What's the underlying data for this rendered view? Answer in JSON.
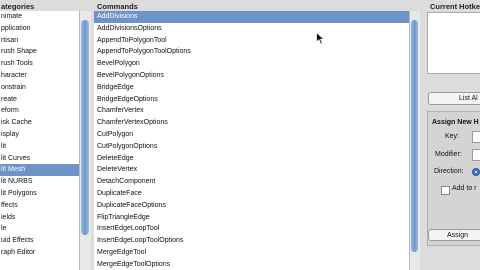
{
  "headers": {
    "categories": "ategories",
    "commands": "Commands",
    "current": "Current Hotke"
  },
  "categories": [
    "nimate",
    "pplication",
    "rtisan",
    "rush Shape",
    "rush Tools",
    "haracter",
    "onstrain",
    "reate",
    "eform",
    "isk Cache",
    "isplay",
    "lit",
    "lit Curves",
    "lit Mesh",
    "lit NURBS",
    "lit Polygons",
    "ffects",
    "ields",
    "le",
    "uid Effects",
    "raph Editor"
  ],
  "selected_category_index": 13,
  "commands": [
    "AddDivisions",
    "AddDivisionsOptions",
    "AppendToPolygonTool",
    "AppendToPolygonToolOptions",
    "BevelPolygon",
    "BevelPolygonOptions",
    "BridgeEdge",
    "BridgeEdgeOptions",
    "ChamferVertex",
    "ChamferVertexOptions",
    "CutPolygon",
    "CutPolygonOptions",
    "DeleteEdge",
    "DeleteVertex",
    "DetachComponent",
    "DuplicateFace",
    "DuplicateFaceOptions",
    "FlipTriangleEdge",
    "InsertEdgeLoopTool",
    "InsertEdgeLoopToolOptions",
    "MergeEdgeTool",
    "MergeEdgeToolOptions"
  ],
  "selected_command_index": 0,
  "right_panel": {
    "list_all_label": "List Al",
    "assign_group_title": "Assign New H",
    "key_label": "Key:",
    "modifier_label": "Modifier:",
    "direction_label": "Direction:",
    "add_to_label": "Add to r",
    "assign_label": "Assign"
  },
  "colors": {
    "selection": "#6d93c9",
    "scroll_thumb": "#6b95cc",
    "panel_bg": "#dcdcdc"
  }
}
